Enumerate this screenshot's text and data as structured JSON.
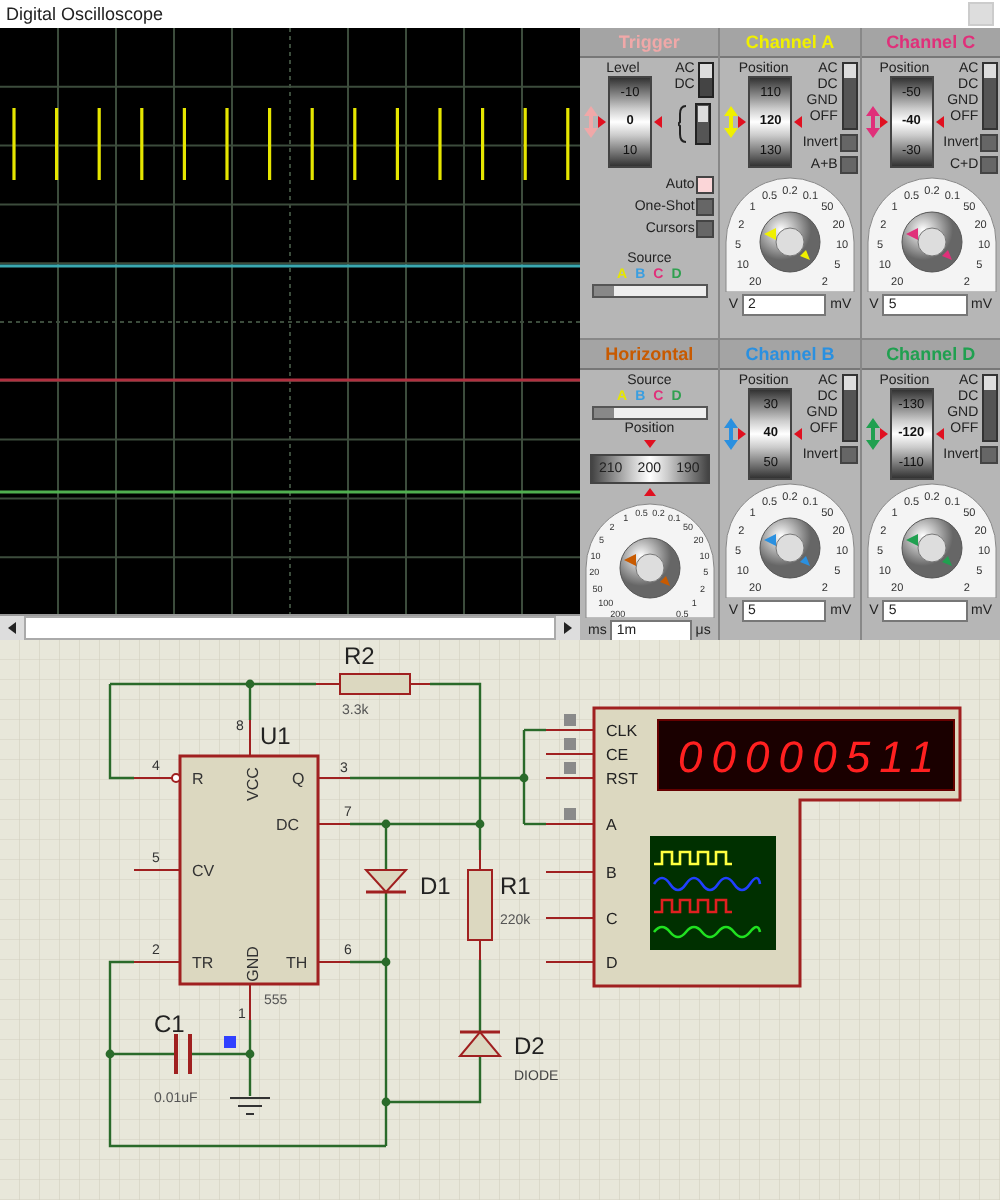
{
  "window": {
    "title": "Digital Oscilloscope"
  },
  "screen": {
    "traces": [
      {
        "kind": "pulse",
        "color": "#e6e600"
      },
      {
        "kind": "flat",
        "color": "#3aa8b0"
      },
      {
        "kind": "flat",
        "color": "#b03040"
      },
      {
        "kind": "flat",
        "color": "#50b050"
      }
    ]
  },
  "panels": [
    {
      "kind": "trigger",
      "title": "Trigger",
      "color": "#f0a8a8",
      "level_label": "Level",
      "scale": [
        "-10",
        "0",
        "10"
      ],
      "coupling": [
        {
          "label": "AC",
          "selected": true
        },
        {
          "label": "DC",
          "selected": false
        }
      ],
      "buttons": [
        {
          "label": "Auto",
          "on": true
        },
        {
          "label": "One-Shot",
          "on": false
        },
        {
          "label": "Cursors",
          "on": false
        }
      ],
      "source_label": "Source",
      "sources": [
        {
          "label": "A",
          "color": "#e6e600"
        },
        {
          "label": "B",
          "color": "#3a9ee0"
        },
        {
          "label": "C",
          "color": "#e0307a"
        },
        {
          "label": "D",
          "color": "#30a050"
        }
      ],
      "source_slider": {
        "level": 0
      }
    },
    {
      "kind": "channel",
      "title": "Channel A",
      "color": "#f0f000",
      "position_label": "Position",
      "scale": [
        "110",
        "120",
        "130"
      ],
      "coupling": [
        {
          "label": "AC",
          "selected": true
        },
        {
          "label": "DC",
          "selected": false
        },
        {
          "label": "GND",
          "selected": false
        },
        {
          "label": "OFF",
          "selected": false
        }
      ],
      "toggles": [
        {
          "label": "Invert",
          "on": false
        },
        {
          "label": "A+B",
          "on": false
        }
      ],
      "dial_labels": [
        "0.2",
        "0.5",
        "0.1",
        "1",
        "50",
        "2",
        "20",
        "5",
        "10",
        "10",
        "5",
        "20",
        "2"
      ],
      "units": [
        "V",
        "mV"
      ],
      "value": "2"
    },
    {
      "kind": "channel",
      "title": "Channel C",
      "color": "#e0307a",
      "position_label": "Position",
      "scale": [
        "-50",
        "-40",
        "-30"
      ],
      "coupling": [
        {
          "label": "AC",
          "selected": true
        },
        {
          "label": "DC",
          "selected": false
        },
        {
          "label": "GND",
          "selected": false
        },
        {
          "label": "OFF",
          "selected": false
        }
      ],
      "toggles": [
        {
          "label": "Invert",
          "on": false
        },
        {
          "label": "C+D",
          "on": false
        }
      ],
      "dial_labels": [
        "0.2",
        "0.5",
        "0.1",
        "1",
        "50",
        "2",
        "20",
        "5",
        "10",
        "10",
        "5",
        "20",
        "2"
      ],
      "units": [
        "V",
        "mV"
      ],
      "value": "5"
    },
    {
      "kind": "horizontal",
      "title": "Horizontal",
      "color": "#c85a00",
      "source_label": "Source",
      "sources": [
        {
          "label": "A",
          "color": "#e6e600"
        },
        {
          "label": "B",
          "color": "#3a9ee0"
        },
        {
          "label": "C",
          "color": "#e0307a"
        },
        {
          "label": "D",
          "color": "#30a050"
        }
      ],
      "source_slider": {
        "level": 0
      },
      "position_label": "Position",
      "scale": [
        "210",
        "200",
        "190"
      ],
      "dial_labels": [
        "0.5",
        "0.2",
        "1",
        "0.1",
        "2",
        "50",
        "5",
        "20",
        "10",
        "10",
        "20",
        "5",
        "50",
        "2",
        "100",
        "1",
        "200",
        "0.5"
      ],
      "units": [
        "ms",
        "μs"
      ],
      "value": "1m"
    },
    {
      "kind": "channel",
      "title": "Channel B",
      "color": "#2a90e0",
      "position_label": "Position",
      "scale": [
        "30",
        "40",
        "50"
      ],
      "coupling": [
        {
          "label": "AC",
          "selected": true
        },
        {
          "label": "DC",
          "selected": false
        },
        {
          "label": "GND",
          "selected": false
        },
        {
          "label": "OFF",
          "selected": false
        }
      ],
      "toggles": [
        {
          "label": "Invert",
          "on": false
        }
      ],
      "dial_labels": [
        "0.2",
        "0.5",
        "0.1",
        "1",
        "50",
        "2",
        "20",
        "5",
        "10",
        "10",
        "5",
        "20",
        "2"
      ],
      "units": [
        "V",
        "mV"
      ],
      "value": "5"
    },
    {
      "kind": "channel",
      "title": "Channel D",
      "color": "#20a050",
      "position_label": "Position",
      "scale": [
        "-130",
        "-120",
        "-110"
      ],
      "coupling": [
        {
          "label": "AC",
          "selected": true
        },
        {
          "label": "DC",
          "selected": false
        },
        {
          "label": "GND",
          "selected": false
        },
        {
          "label": "OFF",
          "selected": false
        }
      ],
      "toggles": [
        {
          "label": "Invert",
          "on": false
        }
      ],
      "dial_labels": [
        "0.2",
        "0.5",
        "0.1",
        "1",
        "50",
        "2",
        "20",
        "5",
        "10",
        "10",
        "5",
        "20",
        "2"
      ],
      "units": [
        "V",
        "mV"
      ],
      "value": "5"
    }
  ],
  "schematic": {
    "parts": [
      {
        "kind": "resistor",
        "ref": "R2",
        "value": "3.3k"
      },
      {
        "kind": "ic",
        "ref": "U1",
        "type": "555",
        "pins": [
          {
            "number": "4",
            "name": "R"
          },
          {
            "number": "3",
            "name": "Q"
          },
          {
            "number": "7",
            "name": "DC"
          },
          {
            "number": "5",
            "name": "CV"
          },
          {
            "number": "2",
            "name": "TR"
          },
          {
            "number": "6",
            "name": "TH"
          },
          {
            "number": "8",
            "name": "VCC"
          },
          {
            "number": "1",
            "name": "GND"
          }
        ]
      },
      {
        "kind": "capacitor",
        "ref": "C1",
        "value": "0.01uF"
      },
      {
        "kind": "diode",
        "ref": "D1"
      },
      {
        "kind": "resistor",
        "ref": "R1",
        "value": "220k"
      },
      {
        "kind": "diode",
        "ref": "D2",
        "value": "DIODE"
      },
      {
        "kind": "counter",
        "display": "00000511",
        "pins": [
          "CLK",
          "CE",
          "RST",
          "A",
          "B",
          "C",
          "D"
        ]
      }
    ]
  }
}
